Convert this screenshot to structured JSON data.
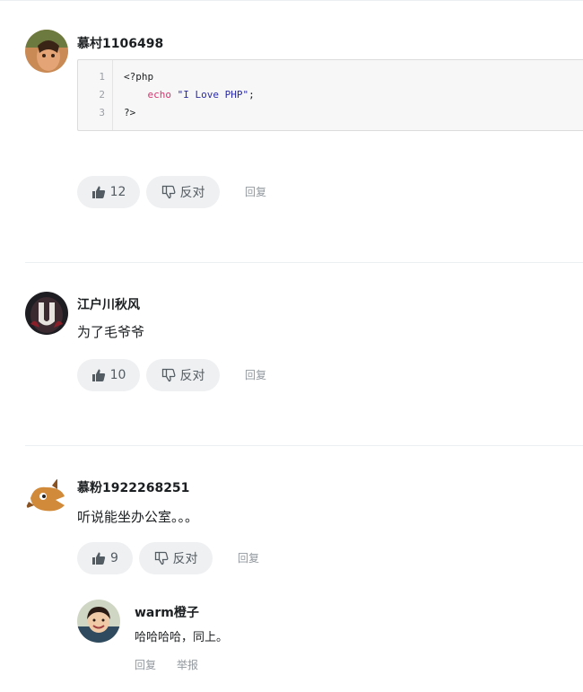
{
  "comments": [
    {
      "username": "慕村1106498",
      "code": {
        "line_numbers": [
          "1",
          "2",
          "3"
        ],
        "line1": "<?php",
        "line2_indent": "    ",
        "line2_keyword": "echo",
        "line2_string": "\"I Love PHP\"",
        "line2_end": ";",
        "line3": "?>"
      },
      "like_count": "12",
      "dislike_label": "反对",
      "reply_label": "回复"
    },
    {
      "username": "江户川秋风",
      "content": "为了毛爷爷",
      "like_count": "10",
      "dislike_label": "反对",
      "reply_label": "回复"
    },
    {
      "username": "慕粉1922268251",
      "content": "听说能坐办公室。。。",
      "like_count": "9",
      "dislike_label": "反对",
      "reply_label": "回复",
      "replies": [
        {
          "username": "warm橙子",
          "content": "哈哈哈哈，同上。",
          "reply_label": "回复",
          "report_label": "举报"
        }
      ]
    }
  ],
  "icons": {
    "like": "thumbs-up-icon",
    "dislike": "thumbs-down-icon"
  },
  "colors": {
    "pill_bg": "#eef0f2",
    "muted_text": "#93999f",
    "code_keyword": "#d7336f",
    "code_string": "#2a2aa6"
  }
}
